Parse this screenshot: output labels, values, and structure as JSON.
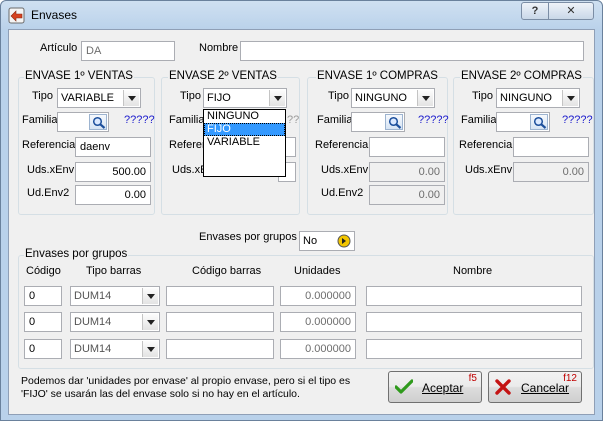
{
  "window": {
    "title": "Envases",
    "help_label": "?",
    "close_label": "✕"
  },
  "header": {
    "articulo_label": "Artículo",
    "articulo_value": "DA",
    "nombre_label": "Nombre",
    "nombre_value": ""
  },
  "sections": {
    "venta1": {
      "title": "ENVASE 1º VENTAS",
      "tipo_label": "Tipo",
      "tipo_value": "VARIABLE",
      "familia_label": "Familia",
      "familia_value": "",
      "familia_qs": "?????",
      "referencia_label": "Referencia",
      "referencia_value": "daenv",
      "uds_label": "Uds.xEnv",
      "uds_value": "500.00",
      "ud_label": "Ud.Env2",
      "ud_value": "0.00"
    },
    "venta2": {
      "title": "ENVASE 2º VENTAS",
      "tipo_label": "Tipo",
      "tipo_value": "FIJO",
      "familia_label": "Familia",
      "familia_qs": "??",
      "referencia_label": "Referen",
      "uds_label": "Uds.xE"
    },
    "compra1": {
      "title": "ENVASE 1º COMPRAS",
      "tipo_label": "Tipo",
      "tipo_value": "NINGUNO",
      "familia_label": "Familia",
      "familia_value": "",
      "familia_qs": "?????",
      "referencia_label": "Referencia",
      "referencia_value": "",
      "uds_label": "Uds.xEnv",
      "uds_value": "0.00",
      "ud_label": "Ud.Env2",
      "ud_value": "0.00"
    },
    "compra2": {
      "title": "ENVASE 2º COMPRAS",
      "tipo_label": "Tipo",
      "tipo_value": "NINGUNO",
      "familia_label": "Familia",
      "familia_value": "",
      "familia_qs": "?????",
      "referencia_label": "Referencia",
      "referencia_value": "",
      "uds_label": "Uds.xEnv",
      "uds_value": "0.00"
    }
  },
  "dropdown": {
    "options": [
      "NINGUNO",
      "FIJO",
      "VARIABLE"
    ],
    "selected": "FIJO"
  },
  "grupos": {
    "toggle_label": "Envases por grupos",
    "toggle_value": "No",
    "box_title": "Envases por grupos",
    "columns": [
      "Código",
      "Tipo barras",
      "Código barras",
      "Unidades",
      "Nombre"
    ],
    "rows": [
      {
        "codigo": "0",
        "tipo": "DUM14",
        "barras": "",
        "unidades": "0.000000",
        "nombre": ""
      },
      {
        "codigo": "0",
        "tipo": "DUM14",
        "barras": "",
        "unidades": "0.000000",
        "nombre": ""
      },
      {
        "codigo": "0",
        "tipo": "DUM14",
        "barras": "",
        "unidades": "0.000000",
        "nombre": ""
      }
    ]
  },
  "footer": {
    "note_line1": "Podemos dar 'unidades por envase' al propio envase, pero si el tipo es",
    "note_line2": "'FIJO' se usarán las del envase solo si no hay en el artículo.",
    "accept_label": "Aceptar",
    "accept_key": "f5",
    "cancel_label": "Cancelar",
    "cancel_key": "f12"
  },
  "colors": {
    "accent": "#3399ff",
    "question_marks": "#1a1acc",
    "fkey": "#c00000"
  },
  "icons": [
    "app-icon",
    "help-icon",
    "close-icon",
    "search-icon",
    "dropdown-arrow-icon",
    "checkmark-icon",
    "x-icon",
    "yes-no-icon"
  ]
}
